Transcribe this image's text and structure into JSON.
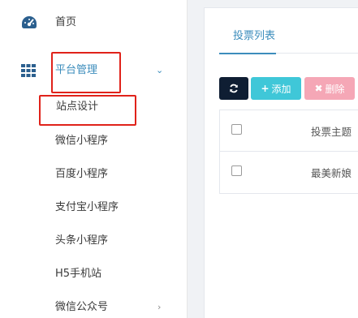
{
  "sidebar": {
    "home_label": "首页",
    "platform_label": "平台管理",
    "sub_items": [
      "站点设计",
      "微信小程序",
      "百度小程序",
      "支付宝小程序",
      "头条小程序",
      "H5手机站",
      "微信公众号"
    ],
    "home_icon": "dashboard-icon",
    "platform_icon": "grid-icon",
    "accent_color": "#3c8dbc"
  },
  "main": {
    "tabs": [
      {
        "label": "投票列表"
      }
    ],
    "toolbar": {
      "refresh_icon": "refresh-icon",
      "add_label": "添加",
      "delete_label": "删除"
    },
    "table": {
      "header": "投票主题",
      "rows": [
        "最美新娘"
      ]
    }
  },
  "annotation_color": "#e0221a"
}
